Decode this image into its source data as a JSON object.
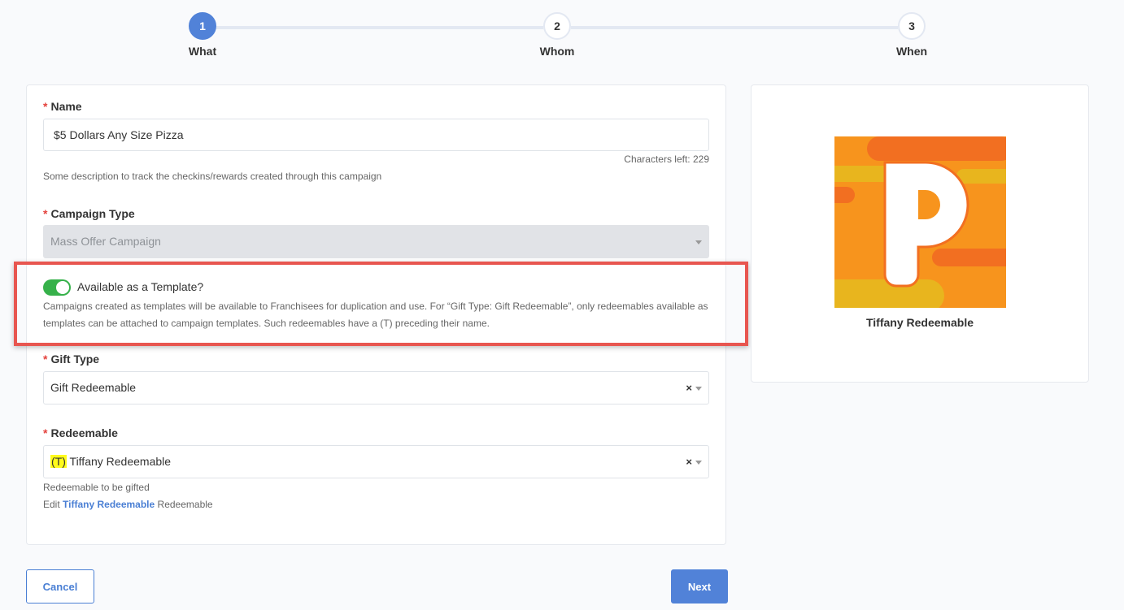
{
  "stepper": {
    "steps": [
      {
        "number": "1",
        "label": "What",
        "active": true
      },
      {
        "number": "2",
        "label": "Whom",
        "active": false
      },
      {
        "number": "3",
        "label": "When",
        "active": false
      }
    ]
  },
  "form": {
    "required_marker": "*",
    "name": {
      "label": "Name",
      "value": "$5 Dollars Any Size Pizza",
      "characters_left": "Characters left: 229",
      "help": "Some description to track the checkins/rewards created through this campaign"
    },
    "campaign_type": {
      "label": "Campaign Type",
      "value": "Mass Offer Campaign"
    },
    "template_toggle": {
      "label": "Available as a Template?",
      "on": true,
      "help": "Campaigns created as templates will be available to Franchisees for duplication and use. For “Gift Type: Gift Redeemable”, only redeemables available as templates can be attached to campaign templates. Such redeemables have a (T) preceding their name."
    },
    "gift_type": {
      "label": "Gift Type",
      "value": "Gift Redeemable",
      "clear": "×"
    },
    "redeemable": {
      "label": "Redeemable",
      "tag": "(T)",
      "value": "Tiffany Redeemable",
      "clear": "×",
      "help": "Redeemable to be gifted",
      "edit_prefix": "Edit",
      "edit_link": "Tiffany Redeemable",
      "edit_suffix": "Redeemable"
    }
  },
  "preview": {
    "name": "Tiffany Redeemable",
    "logo_icon": "p-logo-icon",
    "colors": {
      "orange": "#f7941d",
      "dark_orange": "#f26f21",
      "yellow": "#e8b51e"
    }
  },
  "buttons": {
    "cancel": "Cancel",
    "next": "Next"
  },
  "colors": {
    "primary": "#5182d8",
    "toggle_on": "#36b14a",
    "required": "#e4423d",
    "highlight_box": "#e85650",
    "tag_highlight": "#fffb1a"
  }
}
